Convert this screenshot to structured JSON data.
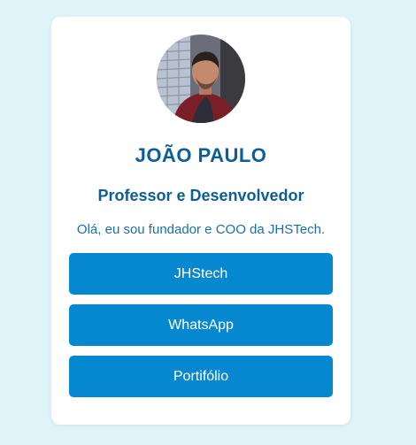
{
  "profile": {
    "name": "JOÃO PAULO",
    "role": "Professor e Desenvolvedor",
    "bio": "Olá, eu sou fundador e COO da JHSTech."
  },
  "links": [
    {
      "label": "JHStech"
    },
    {
      "label": "WhatsApp"
    },
    {
      "label": "Portifólio"
    }
  ],
  "colors": {
    "background": "#dff4f8",
    "card": "#ffffff",
    "heading": "#0d5f93",
    "button": "#0688d0",
    "button_text": "#ffffff"
  },
  "avatar_icon": "profile-photo"
}
